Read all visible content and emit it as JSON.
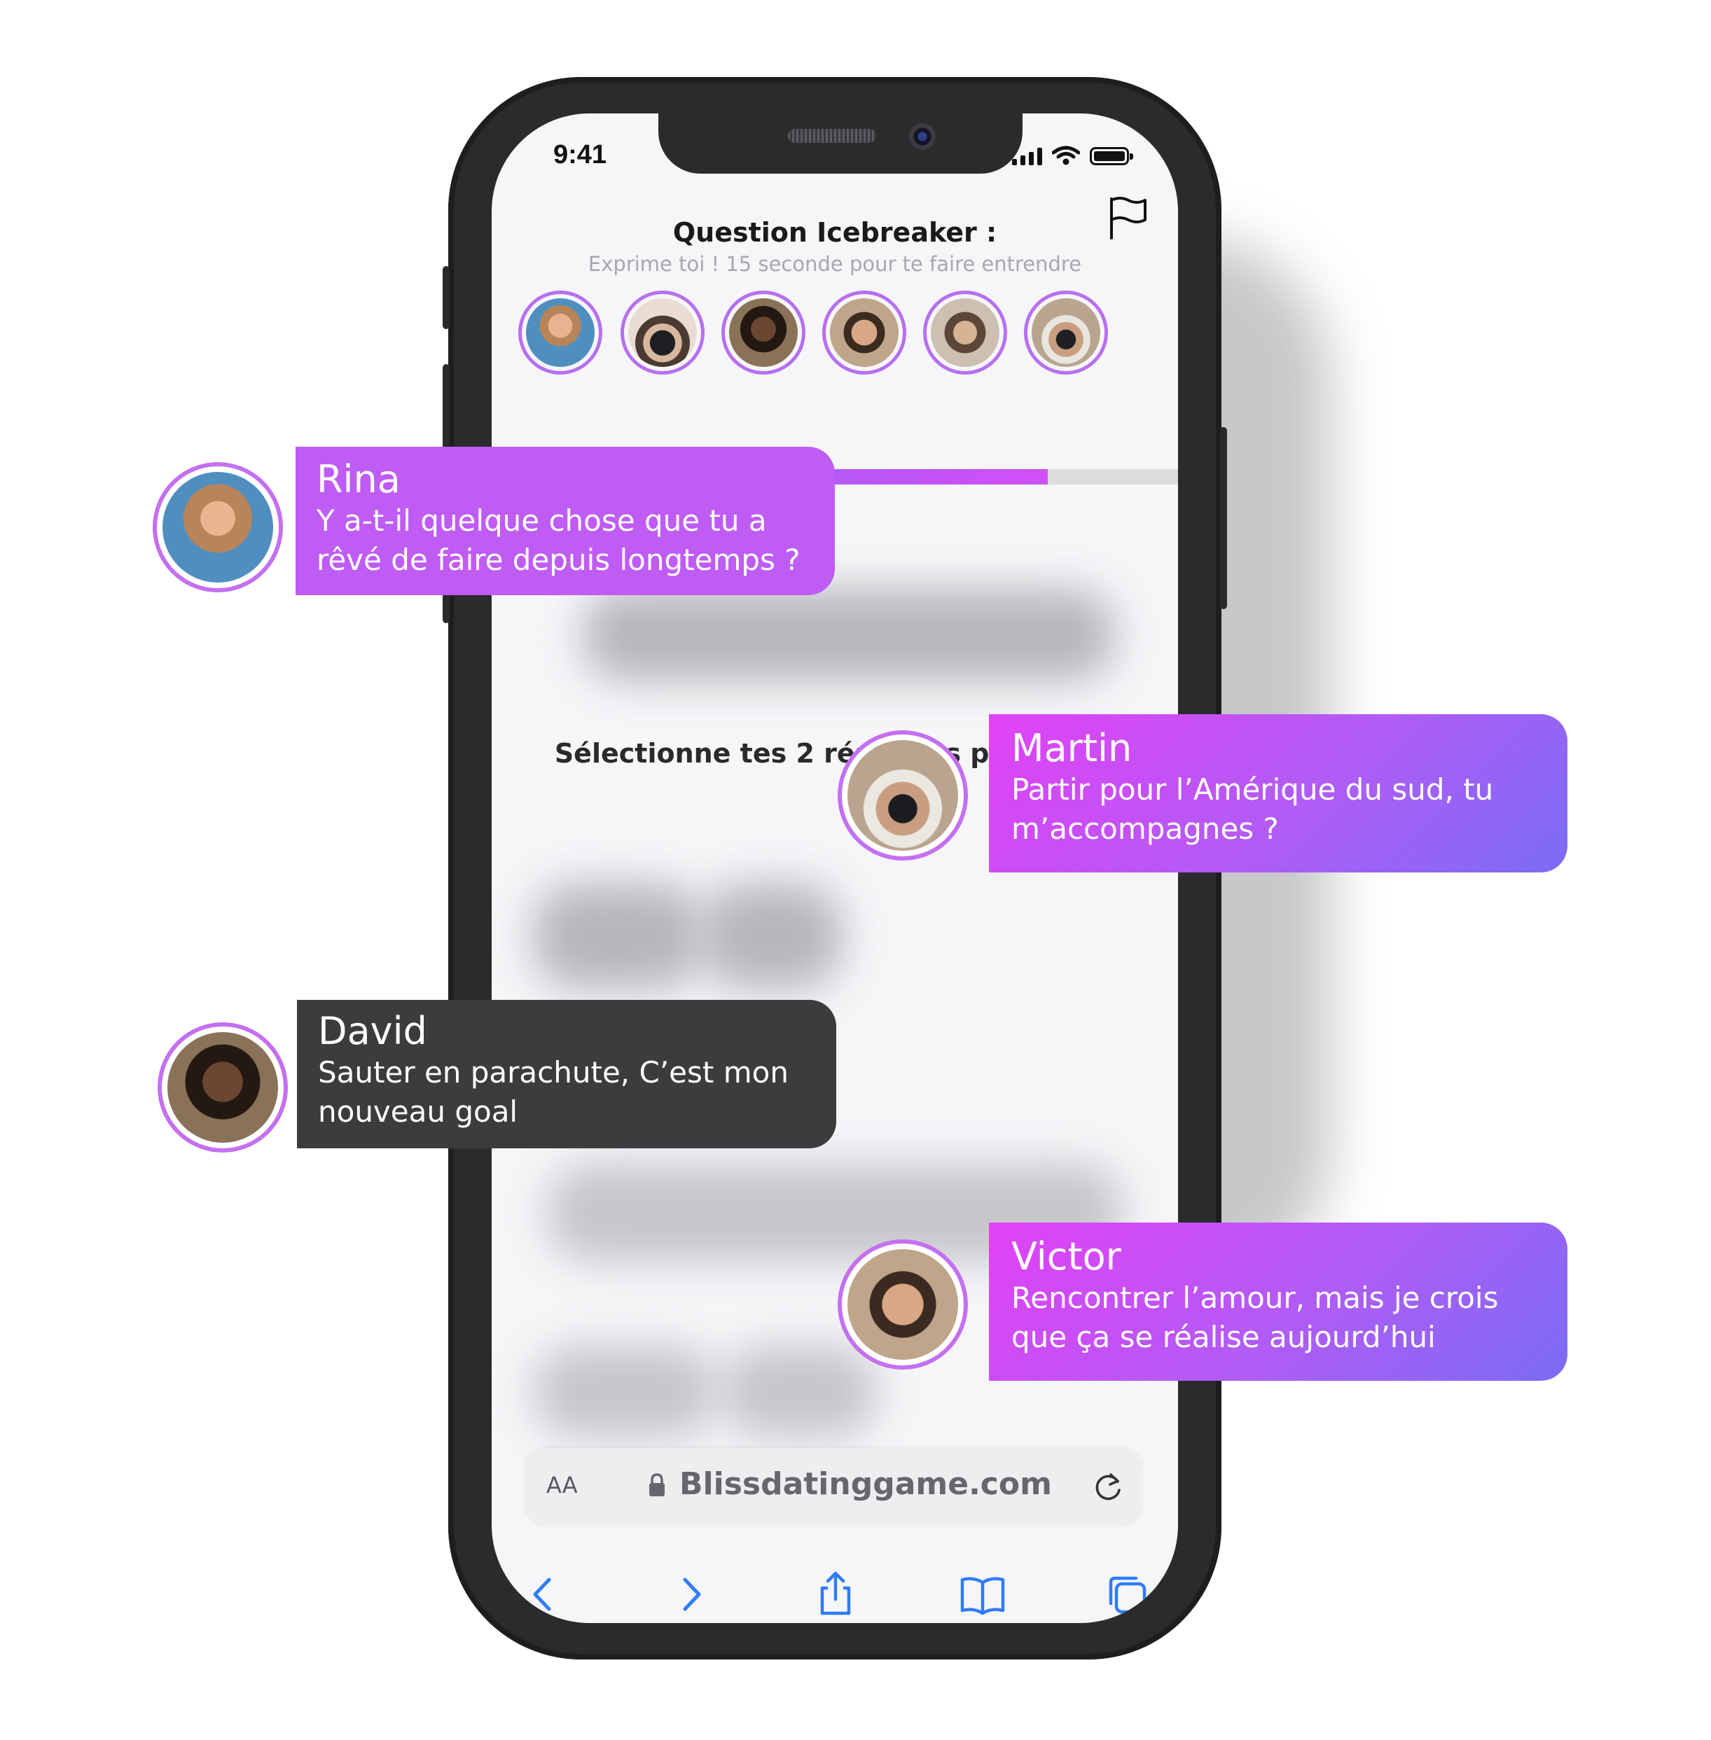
{
  "status_bar": {
    "time": "9:41"
  },
  "header": {
    "title": "Question Icebreaker :",
    "subtitle": "Exprime toi ! 15 seconde pour te faire entrendre"
  },
  "icons": {
    "flag": "flag-icon",
    "lock": "lock-icon",
    "reload": "reload-icon",
    "back": "chevron-left-icon",
    "forward": "chevron-right-icon",
    "share": "share-icon",
    "bookmarks": "book-icon",
    "tabs": "tabs-icon"
  },
  "progress": {
    "value": 0.81,
    "colors": [
      "#8b67f5",
      "#d24ff7"
    ]
  },
  "select_title": "Sélectionne tes 2 réponses préférées",
  "browser": {
    "aa": "AA",
    "url": "Blissdatinggame.com"
  },
  "messages": [
    {
      "name": "Rina",
      "text_line1": "Y a-t-il quelque chose que tu a",
      "text_line2": "rêvé de faire depuis longtemps ?"
    },
    {
      "name": "Martin",
      "text_line1": "Partir pour l’Amérique du sud, tu",
      "text_line2": "m’accompagnes ?"
    },
    {
      "name": "David",
      "text_line1": "Sauter en parachute, C’est mon",
      "text_line2": "nouveau goal"
    },
    {
      "name": "Victor",
      "text_line1": "Rencontrer l’amour, mais je crois",
      "text_line2": "que ça se réalise aujourd’hui"
    }
  ],
  "colors": {
    "accent": "#b770f0",
    "bubble_dark": "#3c3c3e",
    "bubble_purple": "#bf5cf4"
  }
}
